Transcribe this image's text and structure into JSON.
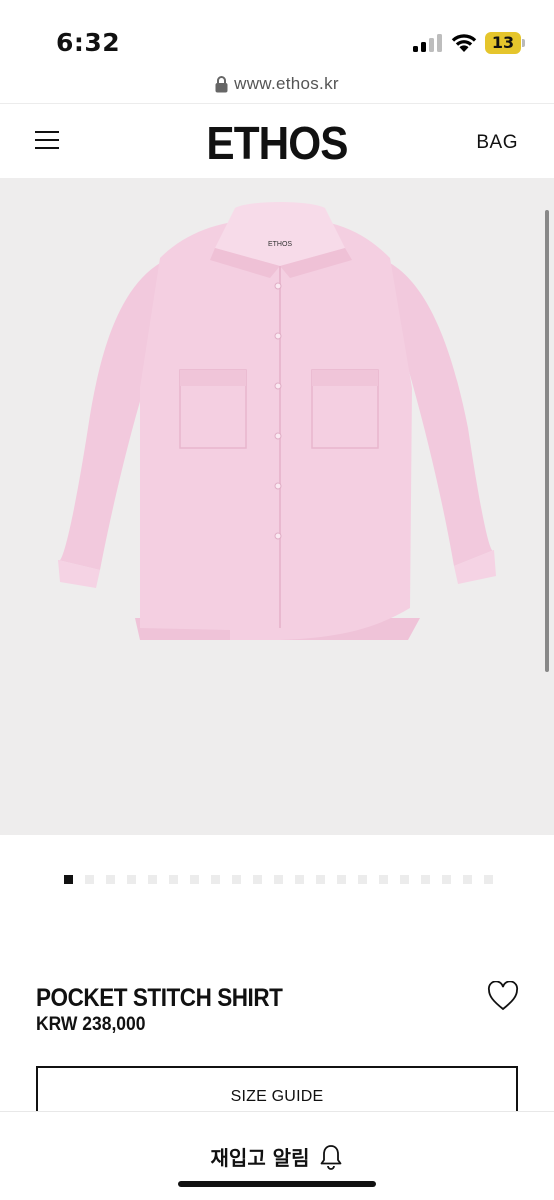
{
  "status_bar": {
    "time": "6:32",
    "battery": "13"
  },
  "browser": {
    "url": "www.ethos.kr"
  },
  "header": {
    "logo": "ETHOS",
    "bag_label": "BAG"
  },
  "gallery": {
    "image_alt": "pink pocket stitch shirt",
    "shirt_label": "ETHOS",
    "slide_count": 21,
    "active_index": 0
  },
  "product": {
    "name": "POCKET STITCH SHIRT",
    "price": "KRW 238,000"
  },
  "size_guide_label": "SIZE GUIDE",
  "restock": {
    "label": "재입고 알림"
  },
  "colors": {
    "shirt": "#f3cce0",
    "gallery_bg": "#eeeded",
    "battery": "#e5c52c"
  }
}
